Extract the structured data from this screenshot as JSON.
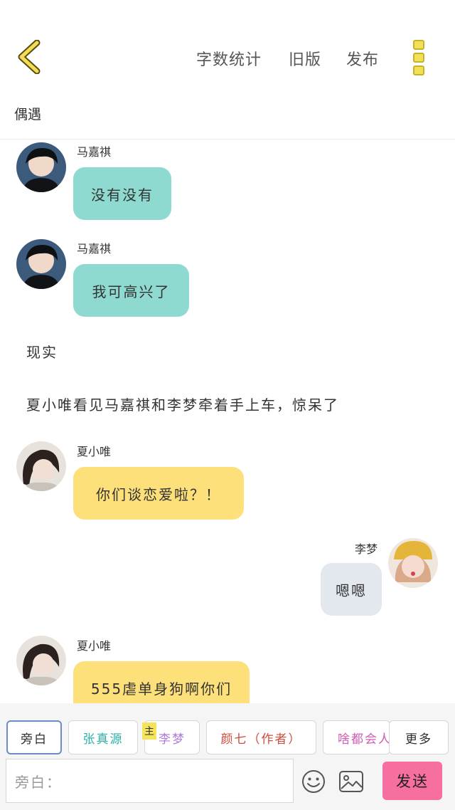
{
  "header": {
    "links": [
      "字数统计",
      "旧版",
      "发布"
    ],
    "title": "偶遇"
  },
  "messages": {
    "m1": {
      "name": "马嘉祺",
      "text": "没有没有"
    },
    "m2": {
      "name": "马嘉祺",
      "text": "我可高兴了"
    },
    "n1": "现实",
    "n2": "夏小唯看见马嘉祺和李梦牵着手上车，惊呆了",
    "m3": {
      "name": "夏小唯",
      "text": "你们谈恋爱啦？！"
    },
    "m4": {
      "name": "李梦",
      "text": "嗯嗯"
    },
    "m5": {
      "name": "夏小唯",
      "text": "555虐单身狗啊你们"
    }
  },
  "roles": {
    "tabs": [
      "旁白",
      "张真源",
      "李梦",
      "颜七（作者）",
      "啥都会人",
      "更多"
    ],
    "tab_colors": [
      "#555555",
      "#2fb0a8",
      "#b07bd6",
      "#d24a3c",
      "#d05bb4",
      "#555555"
    ],
    "main_badge": "主"
  },
  "composer": {
    "placeholder": "旁白：",
    "send_label": "发送",
    "icons": [
      "emoji-icon",
      "image-icon"
    ]
  },
  "colors": {
    "accent": "#f3e05a",
    "teal_bubble": "#8fdad0",
    "yellow_bubble": "#fde07a",
    "gray_bubble": "#e3e7ee",
    "send_button": "#f76ea0"
  }
}
